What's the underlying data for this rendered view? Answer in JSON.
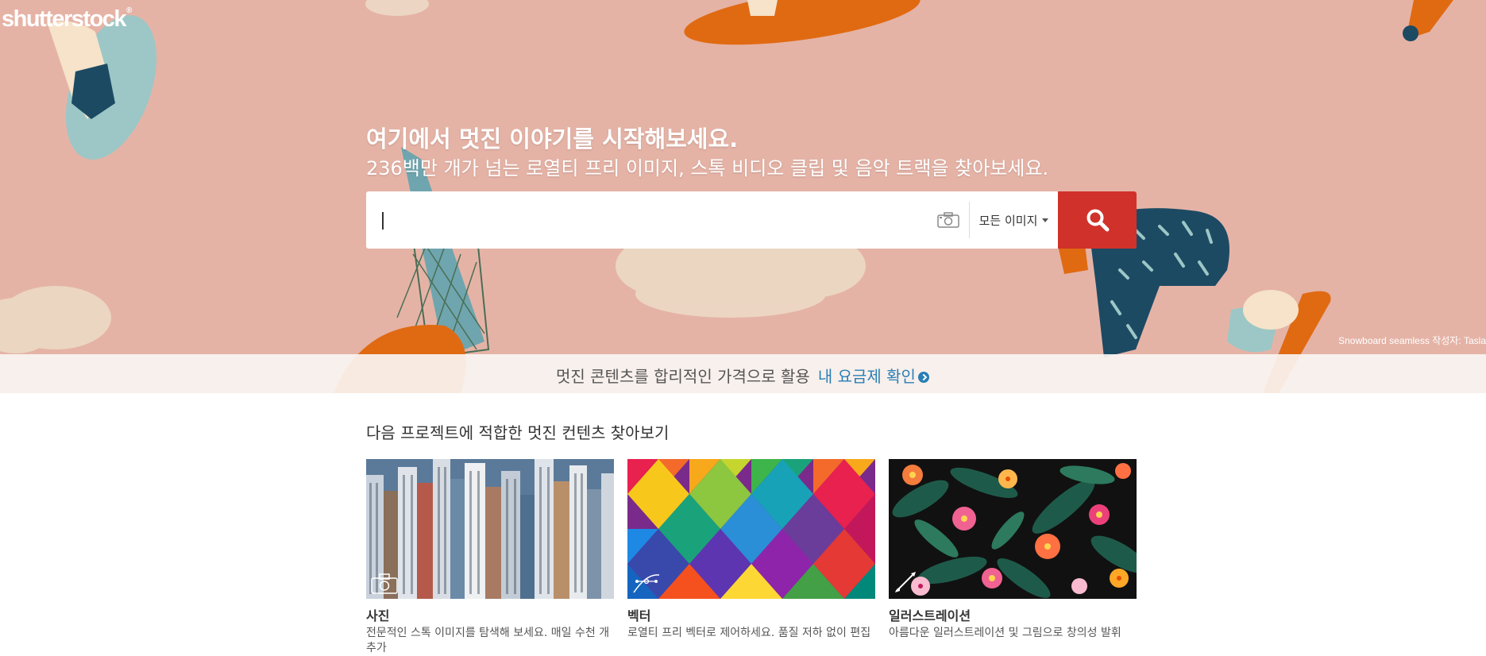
{
  "brand": {
    "logo": "shutterstock",
    "reg": "®"
  },
  "hero": {
    "headline": "여기에서 멋진 이야기를 시작해보세요.",
    "subline": "236백만 개가 넘는 로열티 프리 이미지, 스톡 비디오 클립 및 음악 트랙을 찾아보세요.",
    "credit": "Snowboard seamless 작성자: Tasla"
  },
  "search": {
    "value": "",
    "placeholder": "",
    "type_label": "모든 이미지",
    "colors": {
      "button": "#d0312b"
    }
  },
  "promo": {
    "text": "멋진 콘텐츠를 합리적인 가격으로 활용",
    "link": "내 요금제 확인"
  },
  "section": {
    "title": "다음 프로젝트에 적합한 멋진 컨텐츠 찾아보기",
    "cards": [
      {
        "title": "사진",
        "desc": "전문적인 스톡 이미지를 탐색해 보세요. 매일 수천 개 추가",
        "icon": "camera-icon"
      },
      {
        "title": "벡터",
        "desc": "로열티 프리 벡터로 제어하세요. 품질 저하 없이 편집",
        "icon": "pen-tool-icon"
      },
      {
        "title": "일러스트레이션",
        "desc": "아름다운 일러스트레이션 및 그림으로 창의성 발휘",
        "icon": "brush-icon"
      }
    ]
  }
}
